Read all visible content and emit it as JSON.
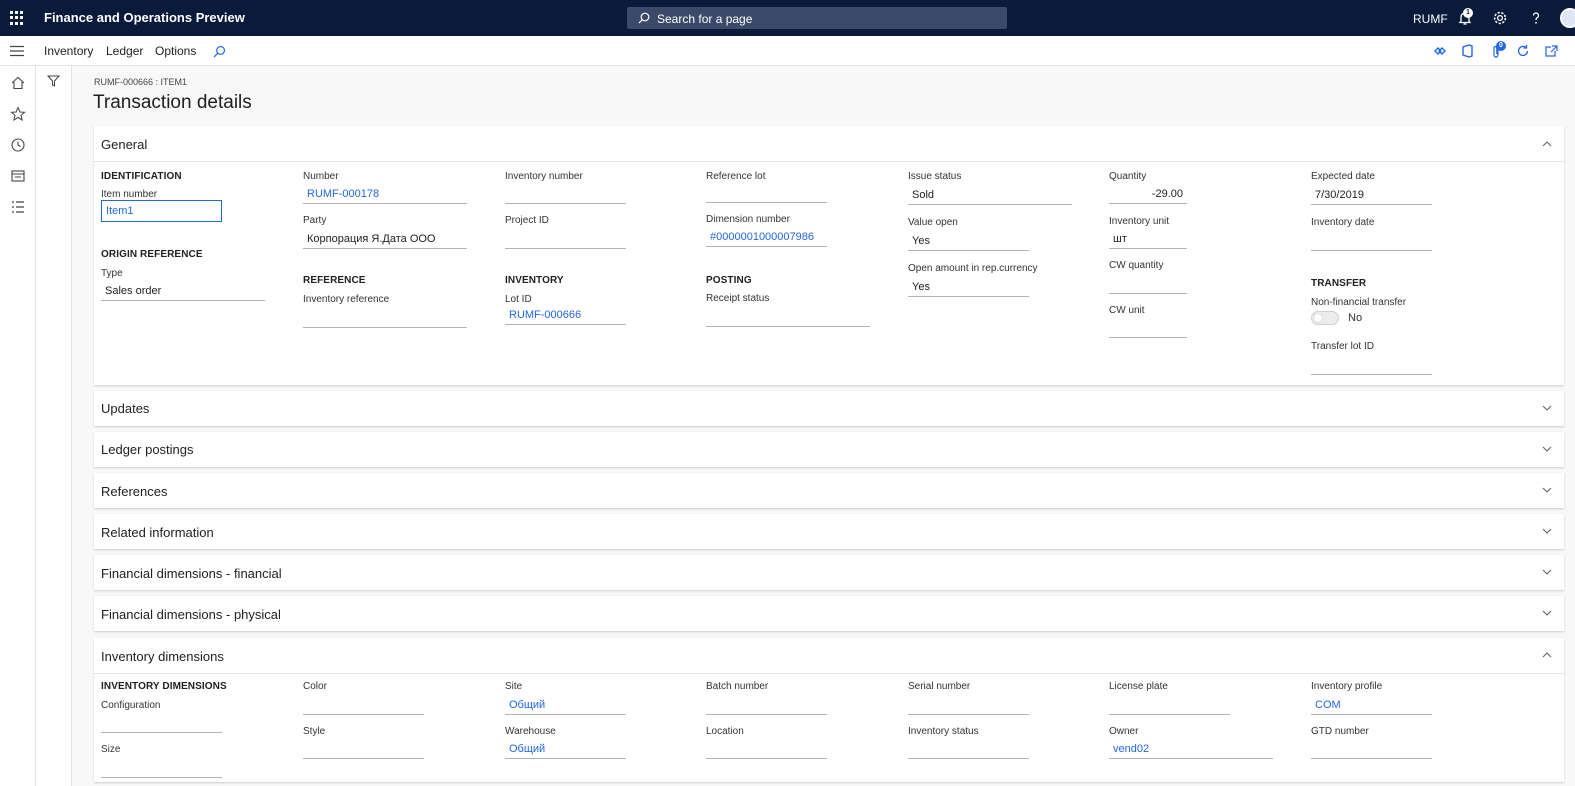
{
  "app": {
    "title": "Finance and Operations Preview",
    "company": "RUMF",
    "notification_count": "1"
  },
  "search": {
    "placeholder": "Search for a page"
  },
  "menu": {
    "tabs": [
      "Inventory",
      "Ledger",
      "Options"
    ],
    "attachments_count": "0"
  },
  "breadcrumb": "RUMF-000666 : ITEM1",
  "page_title": "Transaction details",
  "general": {
    "title": "General",
    "identification": {
      "group": "IDENTIFICATION",
      "item_number_label": "Item number",
      "item_number": "Item1"
    },
    "origin_reference": {
      "group": "ORIGIN REFERENCE",
      "type_label": "Type",
      "type": "Sales order"
    },
    "number_label": "Number",
    "number": "RUMF-000178",
    "party_label": "Party",
    "party": "Корпорация Я.Дата ООО",
    "reference": {
      "group": "REFERENCE",
      "inventory_reference_label": "Inventory reference",
      "inventory_reference": ""
    },
    "inventory_number_label": "Inventory number",
    "inventory_number": "",
    "project_id_label": "Project ID",
    "project_id": "",
    "inventory": {
      "group": "INVENTORY",
      "lot_id_label": "Lot ID",
      "lot_id": "RUMF-000666"
    },
    "reference_lot_label": "Reference lot",
    "reference_lot": "",
    "dimension_number_label": "Dimension number",
    "dimension_number": "#0000001000007986",
    "posting": {
      "group": "POSTING",
      "receipt_status_label": "Receipt status",
      "receipt_status": ""
    },
    "issue_status_label": "Issue status",
    "issue_status": "Sold",
    "value_open_label": "Value open",
    "value_open": "Yes",
    "open_amount_label": "Open amount in rep.currency",
    "open_amount": "Yes",
    "quantity_label": "Quantity",
    "quantity": "-29.00",
    "inventory_unit_label": "Inventory unit",
    "inventory_unit": "шт",
    "cw_quantity_label": "CW quantity",
    "cw_quantity": "",
    "cw_unit_label": "CW unit",
    "cw_unit": "",
    "expected_date_label": "Expected date",
    "expected_date": "7/30/2019",
    "inventory_date_label": "Inventory date",
    "inventory_date": "",
    "transfer": {
      "group": "TRANSFER",
      "non_financial_label": "Non-financial transfer",
      "non_financial": "No",
      "transfer_lot_label": "Transfer lot ID",
      "transfer_lot": ""
    }
  },
  "collapsed_tabs": [
    "Updates",
    "Ledger postings",
    "References",
    "Related information",
    "Financial dimensions - financial",
    "Financial dimensions - physical"
  ],
  "inventory_dimensions": {
    "title": "Inventory dimensions",
    "group": "INVENTORY DIMENSIONS",
    "configuration_label": "Configuration",
    "configuration": "",
    "size_label": "Size",
    "size": "",
    "color_label": "Color",
    "color": "",
    "style_label": "Style",
    "style": "",
    "site_label": "Site",
    "site": "Общий",
    "warehouse_label": "Warehouse",
    "warehouse": "Общий",
    "batch_label": "Batch number",
    "batch": "",
    "location_label": "Location",
    "location": "",
    "serial_label": "Serial number",
    "serial": "",
    "inv_status_label": "Inventory status",
    "inv_status": "",
    "license_label": "License plate",
    "license": "",
    "owner_label": "Owner",
    "owner": "vend02",
    "profile_label": "Inventory profile",
    "profile": "COM",
    "gtd_label": "GTD number",
    "gtd": ""
  },
  "colors": {
    "topbar": "#0a1a3a",
    "link": "#2266e3"
  }
}
